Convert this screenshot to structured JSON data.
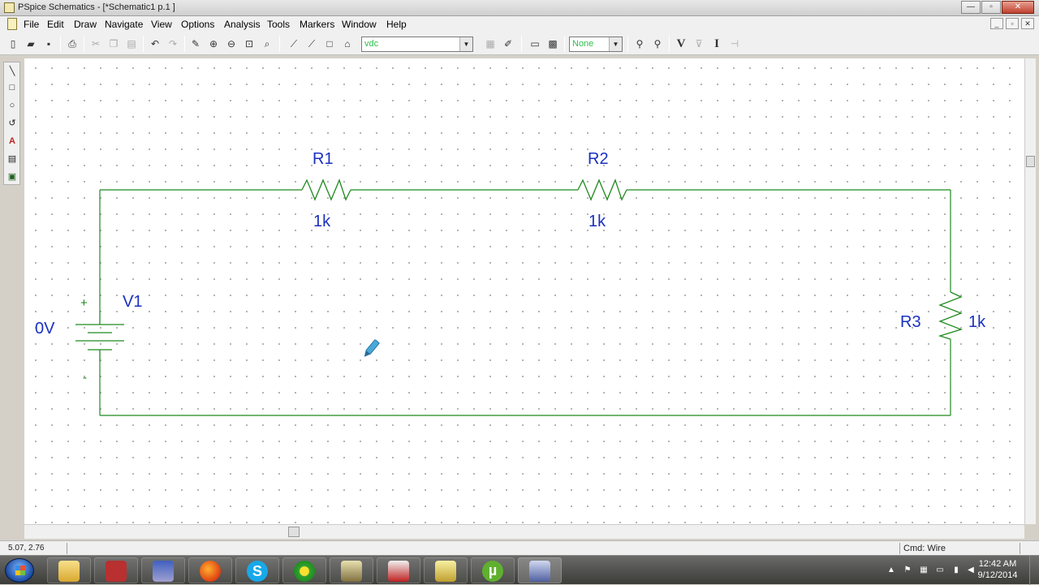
{
  "window": {
    "title": "PSpice Schematics - [*Schematic1  p.1   ]",
    "buttons": {
      "minimize": "—",
      "restore": "▫",
      "close": "✕"
    }
  },
  "menu": [
    "File",
    "Edit",
    "Draw",
    "Navigate",
    "View",
    "Options",
    "Analysis",
    "Tools",
    "Markers",
    "Window",
    "Help"
  ],
  "toolbar": {
    "part_combo": "vdc",
    "marker_combo": "None",
    "bold_v": "V",
    "bold_i": "I"
  },
  "schematic": {
    "components": [
      {
        "ref": "R1",
        "value": "1k",
        "type": "resistor"
      },
      {
        "ref": "R2",
        "value": "1k",
        "type": "resistor"
      },
      {
        "ref": "R3",
        "value": "1k",
        "type": "resistor"
      },
      {
        "ref": "V1",
        "value": "0V",
        "type": "dc-source",
        "plus": "+",
        "minus": "-"
      }
    ],
    "wire_color": "#1e8a1e",
    "label_color": "#1a30c0"
  },
  "status": {
    "coords": "5.07,  2.76",
    "command": "Cmd: Wire"
  },
  "taskbar": {
    "time": "12:42 AM",
    "date": "9/12/2014",
    "apps": [
      "file-explorer",
      "app-red",
      "app-blue",
      "firefox",
      "skype",
      "app-green-circle",
      "app-orcad-window",
      "app-orcad-capture",
      "app-edit",
      "utorrent",
      "pspice-schematics"
    ]
  }
}
